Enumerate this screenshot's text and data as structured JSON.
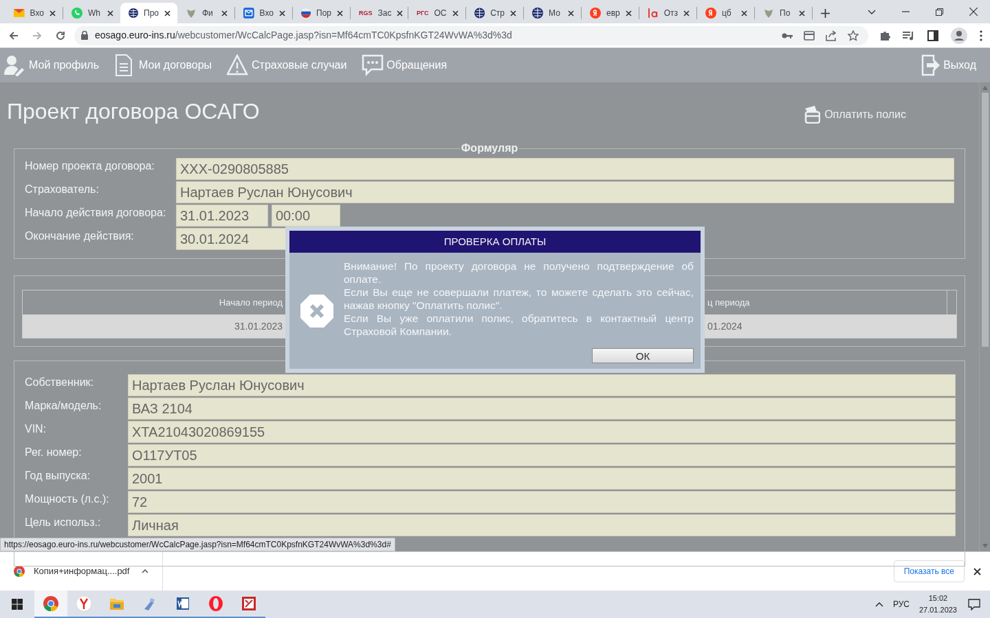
{
  "browser": {
    "tabs": [
      {
        "kind": "mail",
        "title": "Вхо",
        "selected": false
      },
      {
        "kind": "chat",
        "title": "Wh",
        "selected": false
      },
      {
        "kind": "globe",
        "title": "Про",
        "selected": true
      },
      {
        "kind": "emblem",
        "title": "Фи",
        "selected": false
      },
      {
        "kind": "envelope",
        "title": "Вхо",
        "selected": false
      },
      {
        "kind": "flag",
        "title": "Пор",
        "selected": false
      },
      {
        "kind": "text",
        "icon_text": "RGS",
        "title": "Зас",
        "selected": false
      },
      {
        "kind": "text",
        "icon_text": "РГС",
        "title": "ОС",
        "selected": false
      },
      {
        "kind": "globe",
        "title": "Стр",
        "selected": false
      },
      {
        "kind": "globe",
        "title": "Мо",
        "selected": false
      },
      {
        "kind": "ya",
        "title": "евр",
        "selected": false
      },
      {
        "kind": "a",
        "title": "Отз",
        "selected": false
      },
      {
        "kind": "ya",
        "title": "цб",
        "selected": false
      },
      {
        "kind": "emblem",
        "title": "По",
        "selected": false
      }
    ],
    "host": "eosago.euro-ins.ru",
    "path": "/webcustomer/WcCalcPage.jasp?isn=Mf64cmTC0KpsfnKGT24WvWA%3d%3d"
  },
  "nav": {
    "items": [
      {
        "kind": "profile",
        "label": "Мой профиль"
      },
      {
        "kind": "document",
        "label": "Мои договоры"
      },
      {
        "kind": "warning",
        "label": "Страховые случаи"
      },
      {
        "kind": "chat",
        "label": "Обращения"
      }
    ],
    "logout": "Выход"
  },
  "page": {
    "title": "Проект договора ОСАГО",
    "pay_button": "Оплатить полис"
  },
  "form": {
    "legend": "Формуляр",
    "rows": [
      {
        "label": "Номер проекта договора:",
        "values": [
          "XXX-0290805885"
        ]
      },
      {
        "label": "Страхователь:",
        "values": [
          "Нартаев Руслан Юнусович"
        ]
      },
      {
        "label": "Начало действия договора:",
        "values": [
          "31.01.2023",
          "00:00"
        ]
      },
      {
        "label": "Окончание действия:",
        "values": [
          "30.01.2024"
        ]
      }
    ]
  },
  "period_table": {
    "columns": [
      "Начало период",
      "ц периода"
    ],
    "rows": [
      [
        "31.01.2023",
        "01.2024"
      ]
    ]
  },
  "owner": {
    "rows": [
      {
        "label": "Собственник:",
        "value": "Нартаев Руслан Юнусович"
      },
      {
        "label": "Марка/модель:",
        "value": "ВАЗ 2104"
      },
      {
        "label": "VIN:",
        "value": "XTA21043020869155"
      },
      {
        "label": "Рег. номер:",
        "value": "О117УТ05"
      },
      {
        "label": "Год выпуска:",
        "value": "2001"
      },
      {
        "label": "Мощность (л.с.):",
        "value": "72"
      },
      {
        "label": "Цель использ.:",
        "value": "Личная"
      }
    ]
  },
  "status_url": "https://eosago.euro-ins.ru/webcustomer/WcCalcPage.jasp?isn=Mf64cmTC0KpsfnKGT24WvWA%3d%3d#",
  "downloads": {
    "file": "Копия+информац....pdf",
    "show_all": "Показать все"
  },
  "taskbar": {
    "apps": [
      {
        "kind": "chrome",
        "selected": true
      },
      {
        "kind": "ya",
        "selected": false
      },
      {
        "kind": "folder",
        "selected": false
      },
      {
        "kind": "tool",
        "selected": false
      },
      {
        "kind": "word",
        "selected": false
      },
      {
        "kind": "opera",
        "selected": false
      },
      {
        "kind": "redapp",
        "selected": false
      }
    ],
    "lang": "РУС",
    "time": "15:02",
    "date": "27.01.2023"
  },
  "dialog": {
    "title": "ПРОВЕРКА ОПЛАТЫ",
    "paragraphs": [
      "Внимание! По проекту договора не получено подтверждение об оплате.",
      "Если Вы еще не совершали платеж, то можете сделать это сейчас, нажав кнопку \"Оплатить полис\".",
      "Если Вы уже оплатили полис, обратитесь в контактный центр Страховой Компании."
    ],
    "button": "ОК"
  }
}
